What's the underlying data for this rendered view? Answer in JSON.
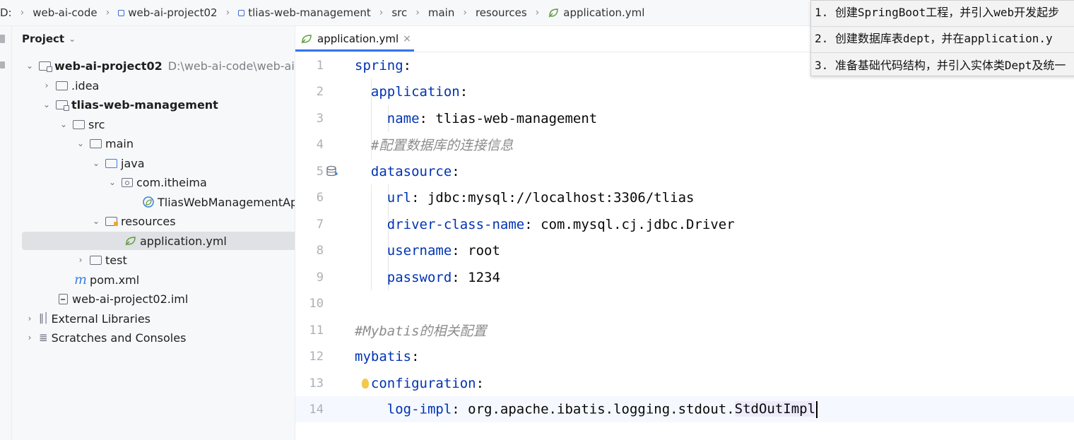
{
  "breadcrumb": {
    "items": [
      "D:",
      "web-ai-code",
      "web-ai-project02",
      "tlias-web-management",
      "src",
      "main",
      "resources",
      "application.yml"
    ]
  },
  "project_panel": {
    "title": "Project",
    "tree": [
      {
        "label": "web-ai-project02",
        "path": "D:\\web-ai-code\\web-ai-p"
      },
      {
        "label": ".idea"
      },
      {
        "label": "tlias-web-management"
      },
      {
        "label": "src"
      },
      {
        "label": "main"
      },
      {
        "label": "java"
      },
      {
        "label": "com.itheima"
      },
      {
        "label": "TliasWebManagementAp"
      },
      {
        "label": "resources"
      },
      {
        "label": "application.yml"
      },
      {
        "label": "test"
      },
      {
        "label": "pom.xml"
      },
      {
        "label": "web-ai-project02.iml"
      },
      {
        "label": "External Libraries"
      },
      {
        "label": "Scratches and Consoles"
      }
    ]
  },
  "editor": {
    "tab_label": "application.yml",
    "lines": [
      {
        "num": "1",
        "key": "spring",
        "punct": ":",
        "value": ""
      },
      {
        "num": "2",
        "key": "application",
        "punct": ":",
        "value": ""
      },
      {
        "num": "3",
        "key": "name",
        "punct": ": ",
        "value": "tlias-web-management"
      },
      {
        "num": "4",
        "comment": "#配置数据库的连接信息"
      },
      {
        "num": "5",
        "key": "datasource",
        "punct": ":",
        "value": ""
      },
      {
        "num": "6",
        "key": "url",
        "punct": ": ",
        "value": "jdbc:mysql://localhost:3306/tlias"
      },
      {
        "num": "7",
        "key": "driver-class-name",
        "punct": ": ",
        "value": "com.mysql.cj.jdbc.Driver"
      },
      {
        "num": "8",
        "key": "username",
        "punct": ": ",
        "value": "root"
      },
      {
        "num": "9",
        "key": "password",
        "punct": ": ",
        "value": "1234"
      },
      {
        "num": "10"
      },
      {
        "num": "11",
        "comment": "#Mybatis的相关配置"
      },
      {
        "num": "12",
        "key": "mybatis",
        "punct": ":",
        "value": ""
      },
      {
        "num": "13",
        "key": "configuration",
        "punct": ":",
        "value": ""
      },
      {
        "num": "14",
        "key": "log-impl",
        "punct": ": ",
        "value": "org.apache.ibatis.logging.stdout.",
        "value_hl": "StdOutImpl"
      }
    ]
  },
  "notes": [
    "1. 创建SpringBoot工程，并引入web开发起步",
    "2. 创建数据库表dept，并在application.y",
    "3. 准备基础代码结构，并引入实体类Dept及统一"
  ],
  "colors": {
    "accent": "#3574f0",
    "key": "#0033b3",
    "string": "#067d17",
    "comment": "#8c8c8c"
  }
}
